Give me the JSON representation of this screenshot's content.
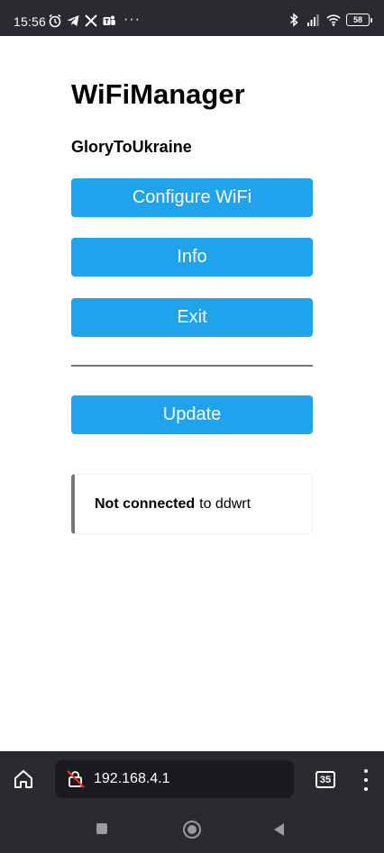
{
  "status_bar": {
    "time": "15:56",
    "left_icons": [
      "alarm-icon",
      "telegram-icon",
      "x-icon",
      "teams-icon"
    ],
    "more": "···",
    "right_icons": [
      "bluetooth-icon",
      "signal-icon",
      "wifi-icon",
      "battery-icon"
    ],
    "battery": "58"
  },
  "page": {
    "title": "WiFiManager",
    "device_name": "GloryToUkraine",
    "buttons": {
      "configure": "Configure WiFi",
      "info": "Info",
      "exit": "Exit",
      "update": "Update"
    },
    "message": {
      "bold": "Not connected",
      "rest": "to ddwrt"
    },
    "accent_color": "#1fa3ec"
  },
  "browser": {
    "url": "192.168.4.1",
    "tab_count": "35"
  }
}
